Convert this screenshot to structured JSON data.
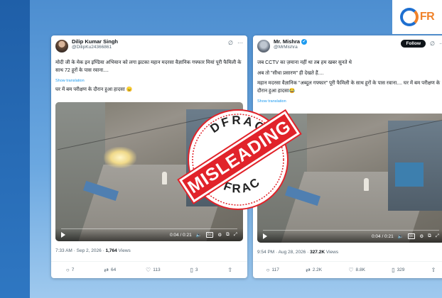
{
  "logo": {
    "text_main": "D",
    "text_accent": "FR",
    "brand_color": "#1e6fd0",
    "accent_color": "#f0822a"
  },
  "left_tweet": {
    "display_name": "Dilip Kumar Singh",
    "handle": "@DilipKu24366861",
    "text_line1": "मोदी जी के मेक इन इण्डिया अभियान को लगा झटका महान मदरसा वैज्ञानिक गफ्फार मियां पूरी फैमिली के साथ 72 हूरों के पास रवाना....",
    "show_translation": "Show translation",
    "text_line2": "घर में बम परीक्षण के दौरान हुआ हादसा 😠",
    "video_time": "0:04 / 0:21",
    "timestamp": "7:33 AM · Sep 2, 2026 · ",
    "views_count": "1,764",
    "views_label": " Views",
    "replies": "7",
    "reposts": "64",
    "likes": "113",
    "bookmarks": "3"
  },
  "right_tweet": {
    "display_name": "Mr. Mishra",
    "handle": "@MrMishra",
    "follow_label": "Follow",
    "show_translation": "Show translation",
    "text_line1": "जब CCTV का ज़माना नहीं था तब हम खबर सुनते थे",
    "text_line2": "अब तो \"सीधा प्रसारण\" ही देखते हैं....",
    "text_line3": "महान मदरसा वैज्ञानिक \"अब्दुल गफ्फार\" पूरी फैमिली के साथ हूरों के पास रवाना.... घर में बम परीक्षण के दौरान हुआ हादसा😂",
    "video_time": "0:04 / 0:21",
    "timestamp": "9:54 PM · Aug 28, 2026 · ",
    "views_count": "327.2K",
    "views_label": " Views",
    "replies": "117",
    "reposts": "2.2K",
    "likes": "8.8K",
    "bookmarks": "329"
  },
  "stamp": {
    "brand": "DFRAC",
    "verdict": "MISLEADING",
    "color": "#e1232a"
  }
}
